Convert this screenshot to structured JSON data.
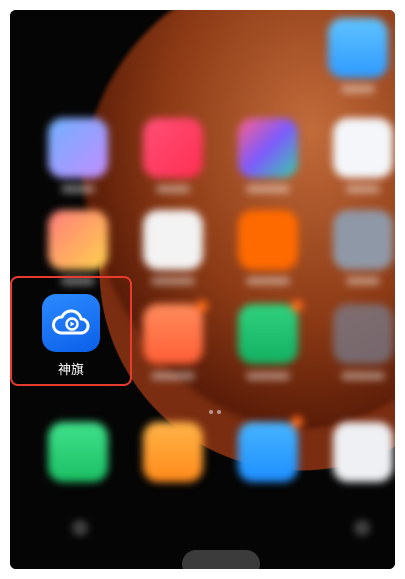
{
  "highlighted_app": {
    "label": "神旗",
    "icon": "cloud-play-icon",
    "color": "#1a6ff0"
  },
  "highlight_color": "#e63b2e"
}
